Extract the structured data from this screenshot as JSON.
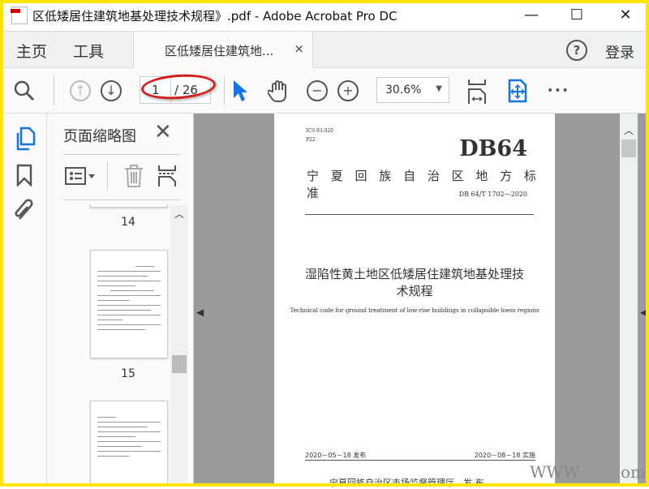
{
  "window": {
    "title": "区低矮居住建筑地基处理技术规程》.pdf - Adobe Acrobat Pro DC",
    "minimize": "—",
    "maximize": "☐",
    "close": "✕"
  },
  "tabs": {
    "home": "主页",
    "tools": "工具",
    "document": "区低矮居住建筑地...",
    "close": "×",
    "help": "?",
    "login": "登录"
  },
  "toolbar": {
    "current_page": "1",
    "total_pages": "/ 26",
    "zoom": "30.6%",
    "more": "•••"
  },
  "panel": {
    "title": "页面缩略图",
    "close": "✕",
    "thumbnails": [
      {
        "label": "14"
      },
      {
        "label": "15"
      }
    ]
  },
  "page": {
    "ics": "ICS 93.020",
    "class": "P22",
    "code": "DB64",
    "authority": "宁 夏 回 族 自 治 区 地 方 标 准",
    "number": "DB 64/T 1702—2020",
    "title_cn_1": "湿陷性黄土地区低矮居住建筑地基处理技",
    "title_cn_2": "术规程",
    "title_en": "Technical code for ground treatment of low-rise buildings in collapsible loess regions",
    "issued": "2020－05－18 发布",
    "implemented": "2020－08－18 实施",
    "publisher": "宁夏回族自治区市场监督管理厅　发 布"
  },
  "watermark": {
    "left": "WWW",
    "right": "om"
  },
  "colors": {
    "accent": "#1473e6",
    "annotation": "#d51c1c",
    "frame": "#ffe600"
  }
}
